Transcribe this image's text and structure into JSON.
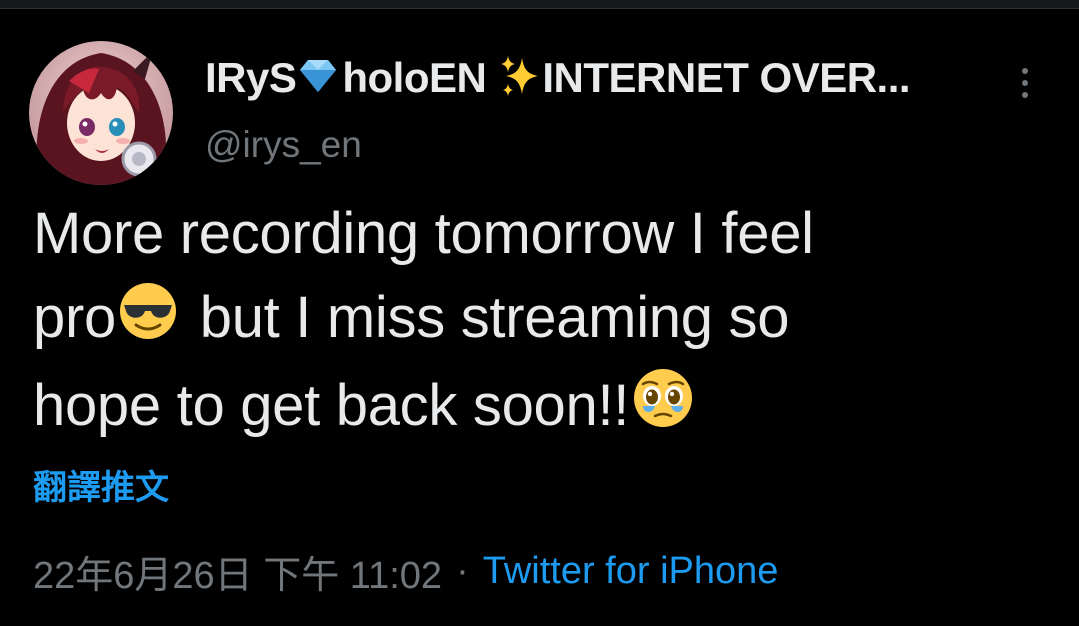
{
  "tweet": {
    "author": {
      "display_name_part1": "IRyS",
      "display_name_part2": "holoEN",
      "display_name_part3": "INTERNET OVER...",
      "emoji_1": "gem-emoji",
      "emoji_2": "sparkles-emoji",
      "handle": "@irys_en",
      "avatar_icon": "avatar-image"
    },
    "text_lines": {
      "line1": "More recording tomorrow I feel",
      "line2_a": "pro",
      "line2_b": " but I miss streaming so",
      "line3": "hope to get back soon!!"
    },
    "text_emojis": [
      "sunglasses-emoji",
      "pleading-tears-emoji"
    ],
    "translate_label": "翻譯推文",
    "timestamp": "22年6月26日 下午 11:02",
    "separator": "·",
    "source": "Twitter for iPhone",
    "colors": {
      "background": "#000000",
      "text": "#e7e9ea",
      "secondary": "#71767b",
      "link": "#1d9bf0"
    },
    "more_icon": "more-vertical-icon"
  }
}
